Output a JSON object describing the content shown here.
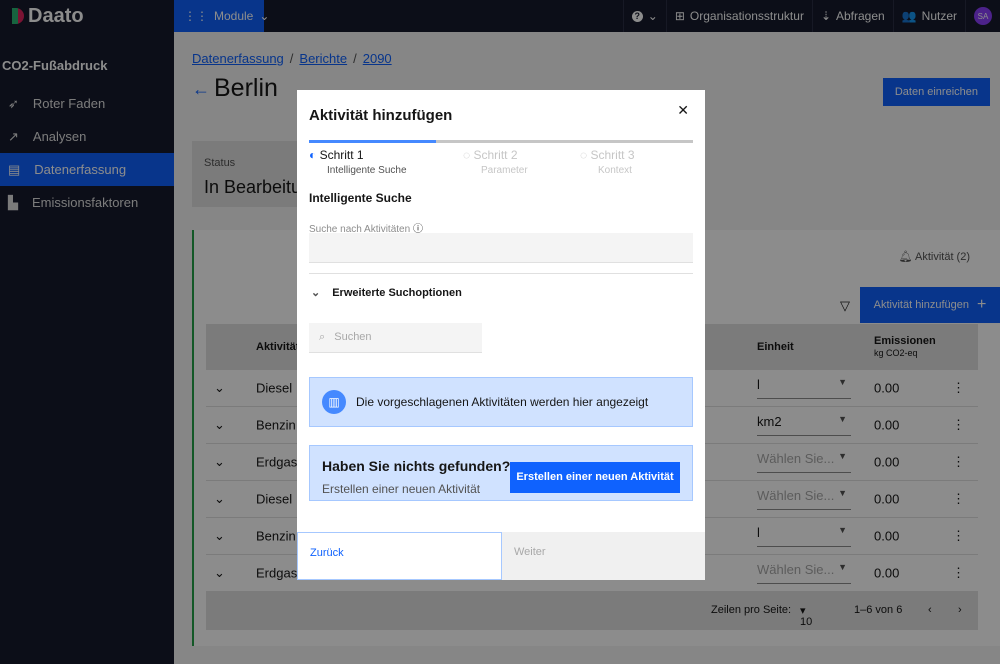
{
  "topbar": {
    "logo": "Daato",
    "module": "Module",
    "help": "?",
    "org": "Organisationsstruktur",
    "queries": "Abfragen",
    "users": "Nutzer",
    "avatar": "SA"
  },
  "sidebar": {
    "title": "CO2-Fußabdruck",
    "items": [
      {
        "label": "Roter Faden",
        "icon": "rocket-icon"
      },
      {
        "label": "Analysen",
        "icon": "chart-icon"
      },
      {
        "label": "Datenerfassung",
        "icon": "clipboard-icon",
        "active": true
      },
      {
        "label": "Emissionsfaktoren",
        "icon": "factor-icon"
      }
    ]
  },
  "breadcrumb": [
    "Datenerfassung",
    "Berichte",
    "2090"
  ],
  "page": {
    "title": "Berlin",
    "submit": "Daten einreichen",
    "status_label": "Status",
    "status_value": "In Bearbeitung"
  },
  "card": {
    "activity_count": "Aktivität (2)",
    "add_button": "Aktivität hinzufügen"
  },
  "table": {
    "headers": {
      "activity": "Aktivität",
      "unit": "Einheit",
      "emissions": "Emissionen",
      "emissions_unit": "kg CO2-eq"
    },
    "rows": [
      {
        "activity": "Diesel",
        "unit": "l",
        "emissions": "0.00"
      },
      {
        "activity": "Benzin",
        "unit": "km2",
        "emissions": "0.00"
      },
      {
        "activity": "Erdgas (",
        "unit": "Wählen Sie...",
        "emissions": "0.00"
      },
      {
        "activity": "Diesel",
        "unit": "Wählen Sie...",
        "emissions": "0.00"
      },
      {
        "activity": "Benzin",
        "unit": "l",
        "emissions": "0.00"
      },
      {
        "activity": "Erdgas (",
        "unit": "Wählen Sie...",
        "emissions": "0.00"
      }
    ]
  },
  "pagination": {
    "rows_label": "Zeilen pro Seite:",
    "rows_value": "10",
    "range": "1–6 von 6"
  },
  "modal": {
    "title": "Aktivität hinzufügen",
    "progress": 0.33,
    "steps": [
      {
        "label": "Schritt 1",
        "sub": "Intelligente Suche"
      },
      {
        "label": "Schritt 2",
        "sub": "Parameter"
      },
      {
        "label": "Schritt 3",
        "sub": "Kontext"
      }
    ],
    "section": "Intelligente Suche",
    "search_label": "Suche nach Aktivitäten",
    "advanced": "Erweiterte Suchoptionen",
    "search_placeholder": "Suchen",
    "info": "Die vorgeschlagenen Aktivitäten werden hier angezeigt",
    "nf_title": "Haben Sie nichts gefunden?",
    "nf_sub": "Erstellen einer neuen Aktivität",
    "nf_button": "Erstellen einer neuen Aktivität",
    "back": "Zurück",
    "next": "Weiter"
  },
  "colors": {
    "accent": "#0f62fe",
    "nav": "#161a2c"
  }
}
